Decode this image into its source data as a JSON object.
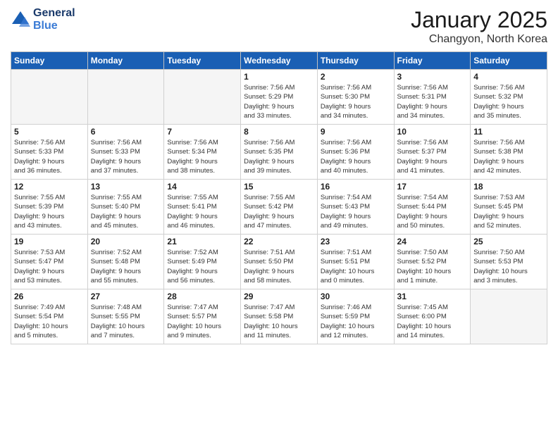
{
  "logo": {
    "line1": "General",
    "line2": "Blue"
  },
  "header": {
    "month": "January 2025",
    "location": "Changyon, North Korea"
  },
  "weekdays": [
    "Sunday",
    "Monday",
    "Tuesday",
    "Wednesday",
    "Thursday",
    "Friday",
    "Saturday"
  ],
  "weeks": [
    [
      {
        "day": "",
        "info": ""
      },
      {
        "day": "",
        "info": ""
      },
      {
        "day": "",
        "info": ""
      },
      {
        "day": "1",
        "info": "Sunrise: 7:56 AM\nSunset: 5:29 PM\nDaylight: 9 hours\nand 33 minutes."
      },
      {
        "day": "2",
        "info": "Sunrise: 7:56 AM\nSunset: 5:30 PM\nDaylight: 9 hours\nand 34 minutes."
      },
      {
        "day": "3",
        "info": "Sunrise: 7:56 AM\nSunset: 5:31 PM\nDaylight: 9 hours\nand 34 minutes."
      },
      {
        "day": "4",
        "info": "Sunrise: 7:56 AM\nSunset: 5:32 PM\nDaylight: 9 hours\nand 35 minutes."
      }
    ],
    [
      {
        "day": "5",
        "info": "Sunrise: 7:56 AM\nSunset: 5:33 PM\nDaylight: 9 hours\nand 36 minutes."
      },
      {
        "day": "6",
        "info": "Sunrise: 7:56 AM\nSunset: 5:33 PM\nDaylight: 9 hours\nand 37 minutes."
      },
      {
        "day": "7",
        "info": "Sunrise: 7:56 AM\nSunset: 5:34 PM\nDaylight: 9 hours\nand 38 minutes."
      },
      {
        "day": "8",
        "info": "Sunrise: 7:56 AM\nSunset: 5:35 PM\nDaylight: 9 hours\nand 39 minutes."
      },
      {
        "day": "9",
        "info": "Sunrise: 7:56 AM\nSunset: 5:36 PM\nDaylight: 9 hours\nand 40 minutes."
      },
      {
        "day": "10",
        "info": "Sunrise: 7:56 AM\nSunset: 5:37 PM\nDaylight: 9 hours\nand 41 minutes."
      },
      {
        "day": "11",
        "info": "Sunrise: 7:56 AM\nSunset: 5:38 PM\nDaylight: 9 hours\nand 42 minutes."
      }
    ],
    [
      {
        "day": "12",
        "info": "Sunrise: 7:55 AM\nSunset: 5:39 PM\nDaylight: 9 hours\nand 43 minutes."
      },
      {
        "day": "13",
        "info": "Sunrise: 7:55 AM\nSunset: 5:40 PM\nDaylight: 9 hours\nand 45 minutes."
      },
      {
        "day": "14",
        "info": "Sunrise: 7:55 AM\nSunset: 5:41 PM\nDaylight: 9 hours\nand 46 minutes."
      },
      {
        "day": "15",
        "info": "Sunrise: 7:55 AM\nSunset: 5:42 PM\nDaylight: 9 hours\nand 47 minutes."
      },
      {
        "day": "16",
        "info": "Sunrise: 7:54 AM\nSunset: 5:43 PM\nDaylight: 9 hours\nand 49 minutes."
      },
      {
        "day": "17",
        "info": "Sunrise: 7:54 AM\nSunset: 5:44 PM\nDaylight: 9 hours\nand 50 minutes."
      },
      {
        "day": "18",
        "info": "Sunrise: 7:53 AM\nSunset: 5:45 PM\nDaylight: 9 hours\nand 52 minutes."
      }
    ],
    [
      {
        "day": "19",
        "info": "Sunrise: 7:53 AM\nSunset: 5:47 PM\nDaylight: 9 hours\nand 53 minutes."
      },
      {
        "day": "20",
        "info": "Sunrise: 7:52 AM\nSunset: 5:48 PM\nDaylight: 9 hours\nand 55 minutes."
      },
      {
        "day": "21",
        "info": "Sunrise: 7:52 AM\nSunset: 5:49 PM\nDaylight: 9 hours\nand 56 minutes."
      },
      {
        "day": "22",
        "info": "Sunrise: 7:51 AM\nSunset: 5:50 PM\nDaylight: 9 hours\nand 58 minutes."
      },
      {
        "day": "23",
        "info": "Sunrise: 7:51 AM\nSunset: 5:51 PM\nDaylight: 10 hours\nand 0 minutes."
      },
      {
        "day": "24",
        "info": "Sunrise: 7:50 AM\nSunset: 5:52 PM\nDaylight: 10 hours\nand 1 minute."
      },
      {
        "day": "25",
        "info": "Sunrise: 7:50 AM\nSunset: 5:53 PM\nDaylight: 10 hours\nand 3 minutes."
      }
    ],
    [
      {
        "day": "26",
        "info": "Sunrise: 7:49 AM\nSunset: 5:54 PM\nDaylight: 10 hours\nand 5 minutes."
      },
      {
        "day": "27",
        "info": "Sunrise: 7:48 AM\nSunset: 5:55 PM\nDaylight: 10 hours\nand 7 minutes."
      },
      {
        "day": "28",
        "info": "Sunrise: 7:47 AM\nSunset: 5:57 PM\nDaylight: 10 hours\nand 9 minutes."
      },
      {
        "day": "29",
        "info": "Sunrise: 7:47 AM\nSunset: 5:58 PM\nDaylight: 10 hours\nand 11 minutes."
      },
      {
        "day": "30",
        "info": "Sunrise: 7:46 AM\nSunset: 5:59 PM\nDaylight: 10 hours\nand 12 minutes."
      },
      {
        "day": "31",
        "info": "Sunrise: 7:45 AM\nSunset: 6:00 PM\nDaylight: 10 hours\nand 14 minutes."
      },
      {
        "day": "",
        "info": ""
      }
    ]
  ]
}
